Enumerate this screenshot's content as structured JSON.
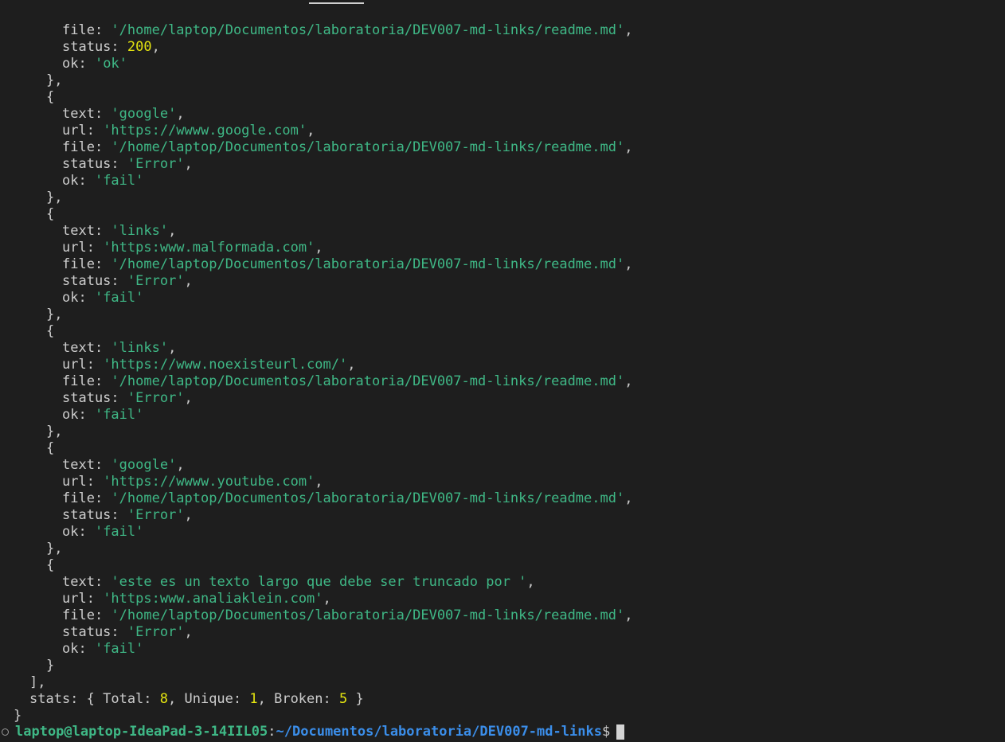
{
  "terminal": {
    "first_entry": {
      "file": "'/home/laptop/Documentos/laboratoria/DEV007-md-links/readme.md'",
      "status": "200",
      "ok": "'ok'"
    },
    "entries": [
      {
        "text": "'google'",
        "url": "'https://wwww.google.com'",
        "file": "'/home/laptop/Documentos/laboratoria/DEV007-md-links/readme.md'",
        "status": "'Error'",
        "ok": "'fail'"
      },
      {
        "text": "'links'",
        "url": "'https:www.malformada.com'",
        "file": "'/home/laptop/Documentos/laboratoria/DEV007-md-links/readme.md'",
        "status": "'Error'",
        "ok": "'fail'"
      },
      {
        "text": "'links'",
        "url": "'https://www.noexisteurl.com/'",
        "file": "'/home/laptop/Documentos/laboratoria/DEV007-md-links/readme.md'",
        "status": "'Error'",
        "ok": "'fail'"
      },
      {
        "text": "'google'",
        "url": "'https://wwww.youtube.com'",
        "file": "'/home/laptop/Documentos/laboratoria/DEV007-md-links/readme.md'",
        "status": "'Error'",
        "ok": "'fail'"
      },
      {
        "text": "'este es un texto largo que debe ser truncado por '",
        "url": "'https:www.analiaklein.com'",
        "file": "'/home/laptop/Documentos/laboratoria/DEV007-md-links/readme.md'",
        "status": "'Error'",
        "ok": "'fail'"
      }
    ],
    "stats": {
      "total": "8",
      "unique": "1",
      "broken": "5"
    },
    "prompt": {
      "user_host": "laptop@laptop-IdeaPad-3-14IIL05",
      "path": "~/Documentos/laboratoria/DEV007-md-links",
      "symbol": "$"
    }
  },
  "colors": {
    "background": "#1e1e1e",
    "string": "#3fb886",
    "number": "#e5e510",
    "path": "#3b8eea",
    "foreground": "#cccccc"
  }
}
